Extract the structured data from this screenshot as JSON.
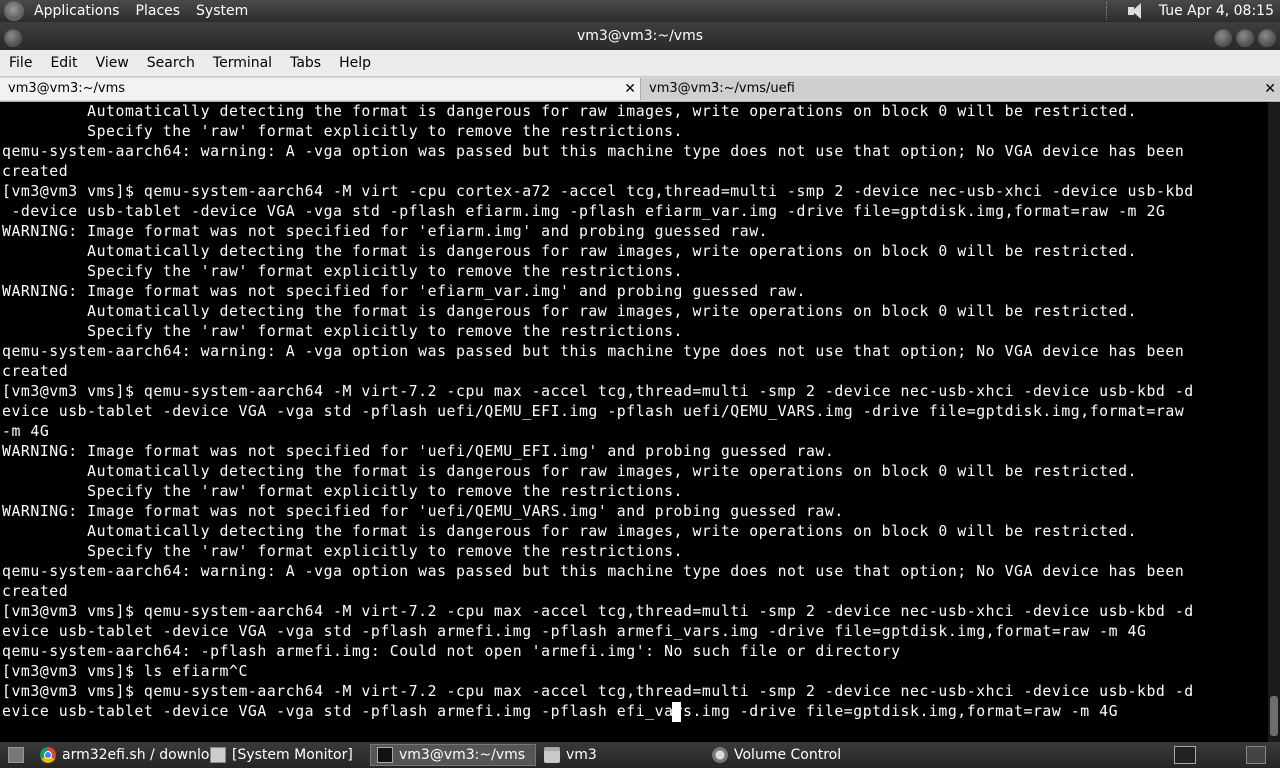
{
  "top_panel": {
    "menus": [
      "Applications",
      "Places",
      "System"
    ],
    "clock": "Tue Apr  4, 08:15"
  },
  "window": {
    "title": "vm3@vm3:~/vms"
  },
  "menu_bar": [
    "File",
    "Edit",
    "View",
    "Search",
    "Terminal",
    "Tabs",
    "Help"
  ],
  "tabs": [
    {
      "label": "vm3@vm3:~/vms",
      "close": "✕"
    },
    {
      "label": "vm3@vm3:~/vms/uefi",
      "close": "✕"
    }
  ],
  "terminal": {
    "lines": [
      "         Automatically detecting the format is dangerous for raw images, write operations on block 0 will be restricted.",
      "         Specify the 'raw' format explicitly to remove the restrictions.",
      "qemu-system-aarch64: warning: A -vga option was passed but this machine type does not use that option; No VGA device has been",
      "created",
      "[vm3@vm3 vms]$ qemu-system-aarch64 -M virt -cpu cortex-a72 -accel tcg,thread=multi -smp 2 -device nec-usb-xhci -device usb-kbd",
      " -device usb-tablet -device VGA -vga std -pflash efiarm.img -pflash efiarm_var.img -drive file=gptdisk.img,format=raw -m 2G",
      "WARNING: Image format was not specified for 'efiarm.img' and probing guessed raw.",
      "         Automatically detecting the format is dangerous for raw images, write operations on block 0 will be restricted.",
      "         Specify the 'raw' format explicitly to remove the restrictions.",
      "WARNING: Image format was not specified for 'efiarm_var.img' and probing guessed raw.",
      "         Automatically detecting the format is dangerous for raw images, write operations on block 0 will be restricted.",
      "         Specify the 'raw' format explicitly to remove the restrictions.",
      "qemu-system-aarch64: warning: A -vga option was passed but this machine type does not use that option; No VGA device has been",
      "created",
      "[vm3@vm3 vms]$ qemu-system-aarch64 -M virt-7.2 -cpu max -accel tcg,thread=multi -smp 2 -device nec-usb-xhci -device usb-kbd -d",
      "evice usb-tablet -device VGA -vga std -pflash uefi/QEMU_EFI.img -pflash uefi/QEMU_VARS.img -drive file=gptdisk.img,format=raw",
      "-m 4G",
      "WARNING: Image format was not specified for 'uefi/QEMU_EFI.img' and probing guessed raw.",
      "         Automatically detecting the format is dangerous for raw images, write operations on block 0 will be restricted.",
      "         Specify the 'raw' format explicitly to remove the restrictions.",
      "WARNING: Image format was not specified for 'uefi/QEMU_VARS.img' and probing guessed raw.",
      "         Automatically detecting the format is dangerous for raw images, write operations on block 0 will be restricted.",
      "         Specify the 'raw' format explicitly to remove the restrictions.",
      "qemu-system-aarch64: warning: A -vga option was passed but this machine type does not use that option; No VGA device has been",
      "created",
      "[vm3@vm3 vms]$ qemu-system-aarch64 -M virt-7.2 -cpu max -accel tcg,thread=multi -smp 2 -device nec-usb-xhci -device usb-kbd -d",
      "evice usb-tablet -device VGA -vga std -pflash armefi.img -pflash armefi_vars.img -drive file=gptdisk.img,format=raw -m 4G",
      "qemu-system-aarch64: -pflash armefi.img: Could not open 'armefi.img': No such file or directory",
      "[vm3@vm3 vms]$ ls efiarm^C",
      "[vm3@vm3 vms]$ qemu-system-aarch64 -M virt-7.2 -cpu max -accel tcg,thread=multi -smp 2 -device nec-usb-xhci -device usb-kbd -d",
      "evice usb-tablet -device VGA -vga std -pflash armefi.img -pflash efi_vars.img -drive file=gptdisk.img,format=raw -m 4G"
    ]
  },
  "taskbar": {
    "items": [
      {
        "label": "arm32efi.sh / downlo...",
        "icon": "chrome-icon"
      },
      {
        "label": "[System Monitor]",
        "icon": "system-monitor-icon"
      },
      {
        "label": "vm3@vm3:~/vms",
        "icon": "terminal-icon"
      },
      {
        "label": "vm3",
        "icon": "folder-icon"
      },
      {
        "label": "Volume Control",
        "icon": "volume-icon"
      }
    ]
  }
}
